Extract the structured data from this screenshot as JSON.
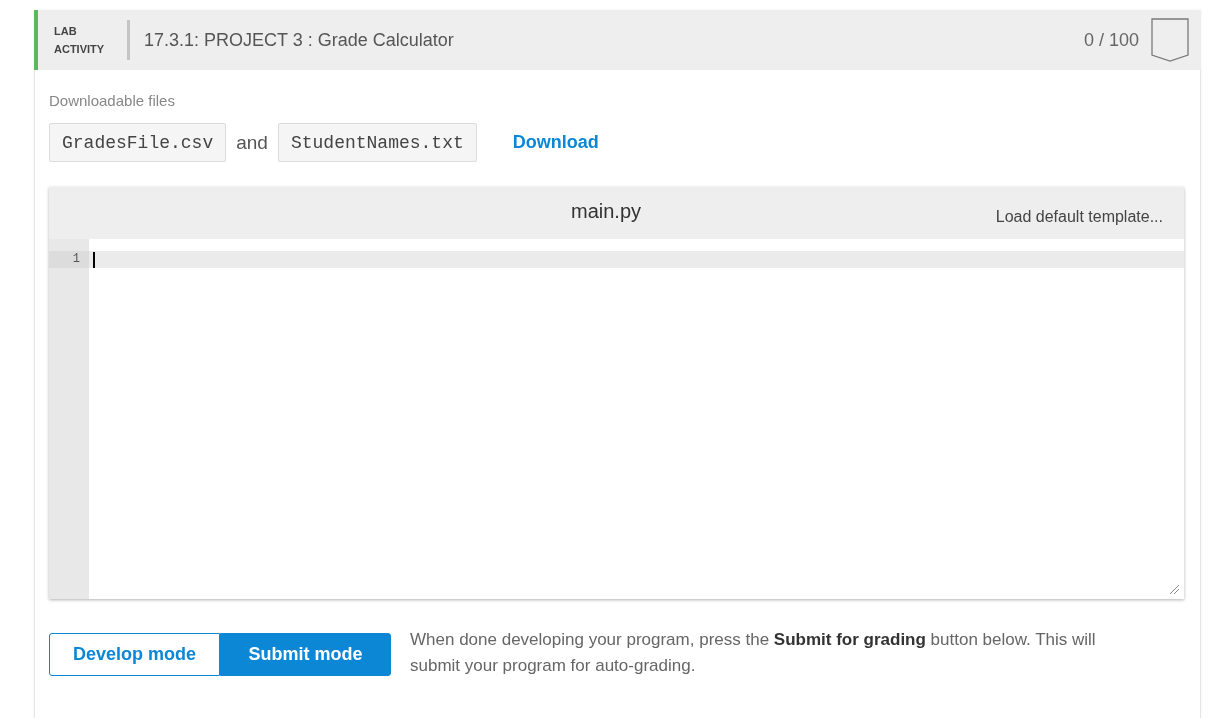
{
  "activity": {
    "type_label": "LAB ACTIVITY",
    "title": "17.3.1: PROJECT 3 : Grade Calculator",
    "score": "0 / 100",
    "completed": false
  },
  "downloads": {
    "label": "Downloadable files",
    "files": [
      "GradesFile.csv",
      "StudentNames.txt"
    ],
    "separator": "and",
    "link": "Download"
  },
  "editor": {
    "filename": "main.py",
    "template_link": "Load default template...",
    "lines": [
      {
        "number": "1",
        "active": true
      }
    ]
  },
  "modes": [
    {
      "label": "Develop mode",
      "selected": false
    },
    {
      "label": "Submit mode",
      "selected": true
    }
  ],
  "instructions": "When done developing your program, press the **Submit for grading** button below. This will submit your program for auto-grading."
}
